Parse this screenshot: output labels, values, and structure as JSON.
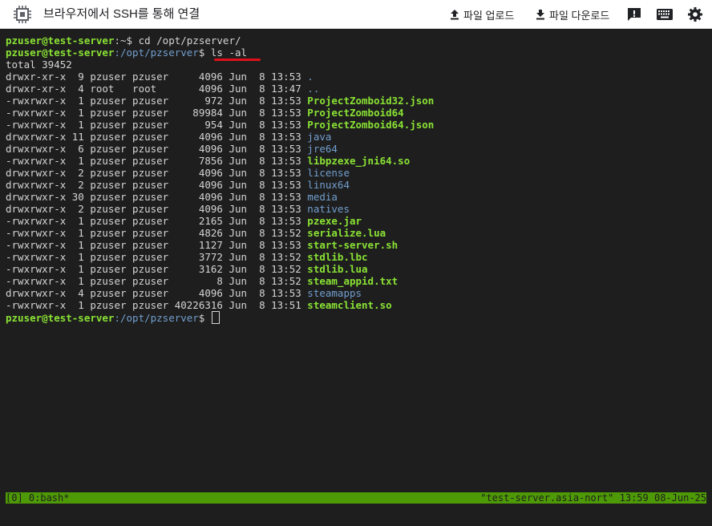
{
  "header": {
    "title": "브라우저에서 SSH를 통해 연결",
    "upload_label": "파일 업로드",
    "download_label": "파일 다운로드",
    "icons": [
      "chip-icon",
      "upload-icon",
      "download-icon",
      "feedback-icon",
      "keyboard-icon",
      "settings-icon"
    ]
  },
  "terminal": {
    "cmd1_prompt_user": "pzuser@test-server",
    "cmd1_prompt_path": ":~$ ",
    "cmd1_text": "cd /opt/pzserver/",
    "cmd2_prompt_user": "pzuser@test-server",
    "cmd2_prompt_path": ":/opt/pzserver",
    "cmd2_prompt_end": "$ ",
    "cmd2_text": "ls -al",
    "total": "total 39452",
    "rows": [
      {
        "perm": "drwxr-xr-x",
        "links": " 9",
        "owner": "pzuser",
        "group": "pzuser",
        "size": "    4096",
        "month": "Jun",
        "day": " 8",
        "time": "13:53",
        "name": ".",
        "type": "dir"
      },
      {
        "perm": "drwxr-xr-x",
        "links": " 4",
        "owner": "root  ",
        "group": "root  ",
        "size": "    4096",
        "month": "Jun",
        "day": " 8",
        "time": "13:47",
        "name": "..",
        "type": "dir"
      },
      {
        "perm": "-rwxrwxr-x",
        "links": " 1",
        "owner": "pzuser",
        "group": "pzuser",
        "size": "     972",
        "month": "Jun",
        "day": " 8",
        "time": "13:53",
        "name": "ProjectZomboid32.json",
        "type": "exec"
      },
      {
        "perm": "-rwxrwxr-x",
        "links": " 1",
        "owner": "pzuser",
        "group": "pzuser",
        "size": "   89984",
        "month": "Jun",
        "day": " 8",
        "time": "13:53",
        "name": "ProjectZomboid64",
        "type": "exec"
      },
      {
        "perm": "-rwxrwxr-x",
        "links": " 1",
        "owner": "pzuser",
        "group": "pzuser",
        "size": "     954",
        "month": "Jun",
        "day": " 8",
        "time": "13:53",
        "name": "ProjectZomboid64.json",
        "type": "exec"
      },
      {
        "perm": "drwxrwxr-x",
        "links": "11",
        "owner": "pzuser",
        "group": "pzuser",
        "size": "    4096",
        "month": "Jun",
        "day": " 8",
        "time": "13:53",
        "name": "java",
        "type": "dir"
      },
      {
        "perm": "drwxrwxr-x",
        "links": " 6",
        "owner": "pzuser",
        "group": "pzuser",
        "size": "    4096",
        "month": "Jun",
        "day": " 8",
        "time": "13:53",
        "name": "jre64",
        "type": "dir"
      },
      {
        "perm": "-rwxrwxr-x",
        "links": " 1",
        "owner": "pzuser",
        "group": "pzuser",
        "size": "    7856",
        "month": "Jun",
        "day": " 8",
        "time": "13:53",
        "name": "libpzexe_jni64.so",
        "type": "exec"
      },
      {
        "perm": "drwxrwxr-x",
        "links": " 2",
        "owner": "pzuser",
        "group": "pzuser",
        "size": "    4096",
        "month": "Jun",
        "day": " 8",
        "time": "13:53",
        "name": "license",
        "type": "dir"
      },
      {
        "perm": "drwxrwxr-x",
        "links": " 2",
        "owner": "pzuser",
        "group": "pzuser",
        "size": "    4096",
        "month": "Jun",
        "day": " 8",
        "time": "13:53",
        "name": "linux64",
        "type": "dir"
      },
      {
        "perm": "drwxrwxr-x",
        "links": "30",
        "owner": "pzuser",
        "group": "pzuser",
        "size": "    4096",
        "month": "Jun",
        "day": " 8",
        "time": "13:53",
        "name": "media",
        "type": "dir"
      },
      {
        "perm": "drwxrwxr-x",
        "links": " 2",
        "owner": "pzuser",
        "group": "pzuser",
        "size": "    4096",
        "month": "Jun",
        "day": " 8",
        "time": "13:53",
        "name": "natives",
        "type": "dir"
      },
      {
        "perm": "-rwxrwxr-x",
        "links": " 1",
        "owner": "pzuser",
        "group": "pzuser",
        "size": "    2165",
        "month": "Jun",
        "day": " 8",
        "time": "13:53",
        "name": "pzexe.jar",
        "type": "exec"
      },
      {
        "perm": "-rwxrwxr-x",
        "links": " 1",
        "owner": "pzuser",
        "group": "pzuser",
        "size": "    4826",
        "month": "Jun",
        "day": " 8",
        "time": "13:52",
        "name": "serialize.lua",
        "type": "exec"
      },
      {
        "perm": "-rwxrwxr-x",
        "links": " 1",
        "owner": "pzuser",
        "group": "pzuser",
        "size": "    1127",
        "month": "Jun",
        "day": " 8",
        "time": "13:53",
        "name": "start-server.sh",
        "type": "exec"
      },
      {
        "perm": "-rwxrwxr-x",
        "links": " 1",
        "owner": "pzuser",
        "group": "pzuser",
        "size": "    3772",
        "month": "Jun",
        "day": " 8",
        "time": "13:52",
        "name": "stdlib.lbc",
        "type": "exec"
      },
      {
        "perm": "-rwxrwxr-x",
        "links": " 1",
        "owner": "pzuser",
        "group": "pzuser",
        "size": "    3162",
        "month": "Jun",
        "day": " 8",
        "time": "13:52",
        "name": "stdlib.lua",
        "type": "exec"
      },
      {
        "perm": "-rwxrwxr-x",
        "links": " 1",
        "owner": "pzuser",
        "group": "pzuser",
        "size": "       8",
        "month": "Jun",
        "day": " 8",
        "time": "13:52",
        "name": "steam_appid.txt",
        "type": "exec"
      },
      {
        "perm": "drwxrwxr-x",
        "links": " 4",
        "owner": "pzuser",
        "group": "pzuser",
        "size": "    4096",
        "month": "Jun",
        "day": " 8",
        "time": "13:53",
        "name": "steamapps",
        "type": "dir"
      },
      {
        "perm": "-rwxrwxr-x",
        "links": " 1",
        "owner": "pzuser",
        "group": "pzuser",
        "size": "40226316",
        "month": "Jun",
        "day": " 8",
        "time": "13:51",
        "name": "steamclient.so",
        "type": "exec"
      }
    ],
    "final_prompt_user": "pzuser@test-server",
    "final_prompt_path": ":/opt/pzserver",
    "final_prompt_end": "$ "
  },
  "status": {
    "left": "[0] 0:bash*",
    "right": "\"test-server.asia-nort\" 13:59 08-Jun-25"
  },
  "colors": {
    "user_green": "#8ae234",
    "path_blue": "#729fcf",
    "status_bg": "#4e9a06",
    "underline_red": "#e0101a"
  }
}
